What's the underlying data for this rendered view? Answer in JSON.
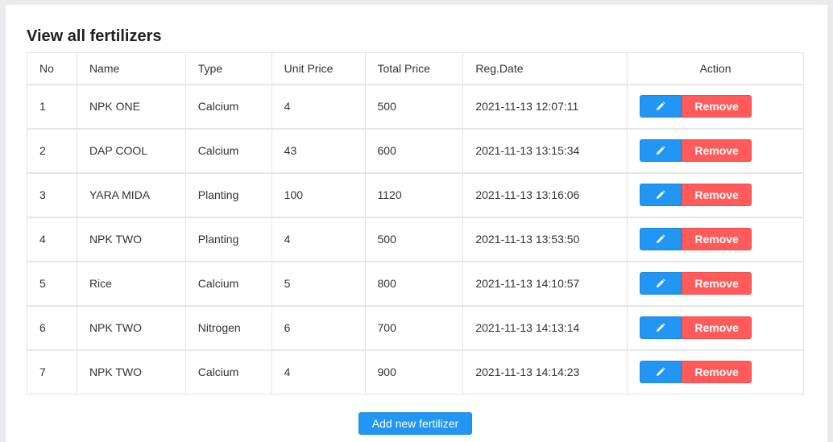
{
  "page": {
    "title": "View all fertilizers"
  },
  "table": {
    "headers": {
      "no": "No",
      "name": "Name",
      "type": "Type",
      "unit_price": "Unit Price",
      "total_price": "Total Price",
      "reg_date": "Reg.Date",
      "action": "Action"
    },
    "rows": [
      {
        "no": "1",
        "name": "NPK ONE",
        "type": "Calcium",
        "unit_price": "4",
        "total_price": "500",
        "reg_date": "2021-11-13 12:07:11"
      },
      {
        "no": "2",
        "name": "DAP COOL",
        "type": "Calcium",
        "unit_price": "43",
        "total_price": "600",
        "reg_date": "2021-11-13 13:15:34"
      },
      {
        "no": "3",
        "name": "YARA MIDA",
        "type": "Planting",
        "unit_price": "100",
        "total_price": "1120",
        "reg_date": "2021-11-13 13:16:06"
      },
      {
        "no": "4",
        "name": "NPK TWO",
        "type": "Planting",
        "unit_price": "4",
        "total_price": "500",
        "reg_date": "2021-11-13 13:53:50"
      },
      {
        "no": "5",
        "name": "Rice",
        "type": "Calcium",
        "unit_price": "5",
        "total_price": "800",
        "reg_date": "2021-11-13 14:10:57"
      },
      {
        "no": "6",
        "name": "NPK TWO",
        "type": "Nitrogen",
        "unit_price": "6",
        "total_price": "700",
        "reg_date": "2021-11-13 14:13:14"
      },
      {
        "no": "7",
        "name": "NPK TWO",
        "type": "Calcium",
        "unit_price": "4",
        "total_price": "900",
        "reg_date": "2021-11-13 14:14:23"
      }
    ],
    "actions": {
      "edit_icon": "pencil-icon",
      "remove_label": "Remove"
    }
  },
  "footer": {
    "add_label": "Add new fertilizer"
  },
  "colors": {
    "primary": "#2196f3",
    "danger": "#ff5b5b",
    "background": "#e9ebee"
  }
}
